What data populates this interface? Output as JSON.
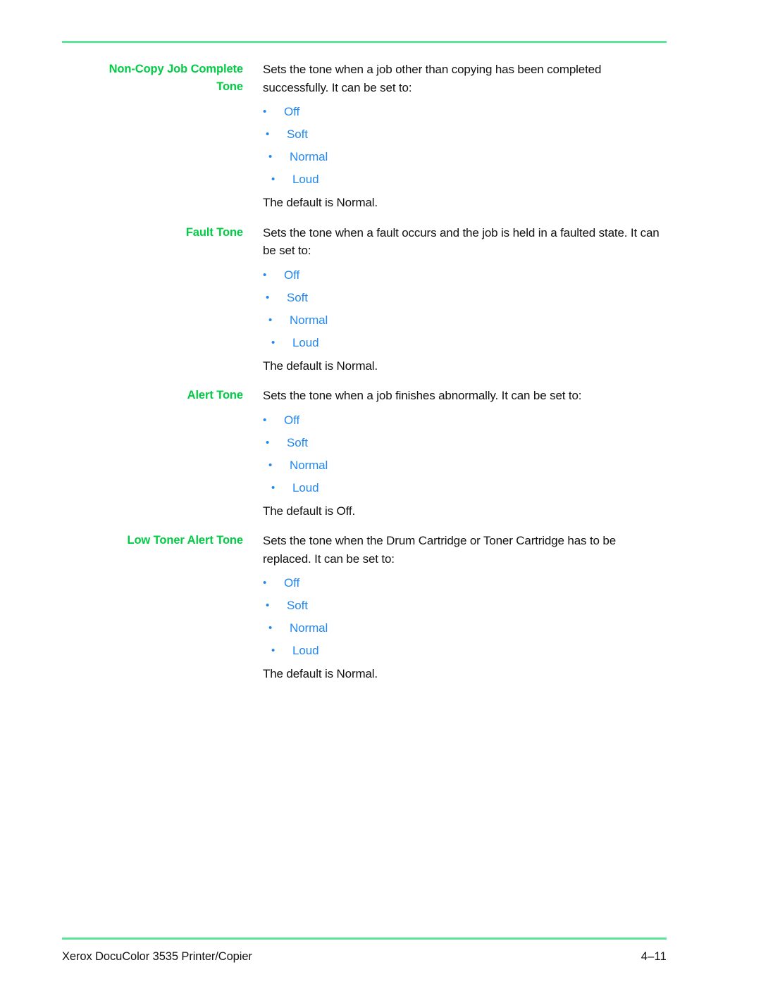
{
  "document": {
    "footer_title": "Xerox DocuColor 3535 Printer/Copier",
    "page_number": "4–11"
  },
  "colors": {
    "label_green": "#00CC44",
    "rule_green": "#5FE39A",
    "option_blue": "#2288EE",
    "body_black": "#121212"
  },
  "entries": [
    {
      "label": "Non-Copy Job Complete\nTone",
      "description": "Sets the tone when a job other than copying has been completed successfully.  It can be set to:",
      "options": [
        "Off",
        "Soft",
        "Normal",
        "Loud"
      ],
      "default": "The default is Normal."
    },
    {
      "label": "Fault Tone",
      "description": "Sets the tone when a fault occurs and the job is held in a faulted state.  It can be set to:",
      "options": [
        "Off",
        "Soft",
        "Normal",
        "Loud"
      ],
      "default": "The default is Normal."
    },
    {
      "label": "Alert Tone",
      "description": "Sets the tone when a job finishes abnormally.  It can be set to:",
      "options": [
        "Off",
        "Soft",
        "Normal",
        "Loud"
      ],
      "default": "The default is Off."
    },
    {
      "label": "Low Toner Alert Tone",
      "description": "Sets the tone when the Drum Cartridge or Toner Cartridge has to be replaced.  It can be set to:",
      "options": [
        "Off",
        "Soft",
        "Normal",
        "Loud"
      ],
      "default": "The default is Normal."
    }
  ]
}
